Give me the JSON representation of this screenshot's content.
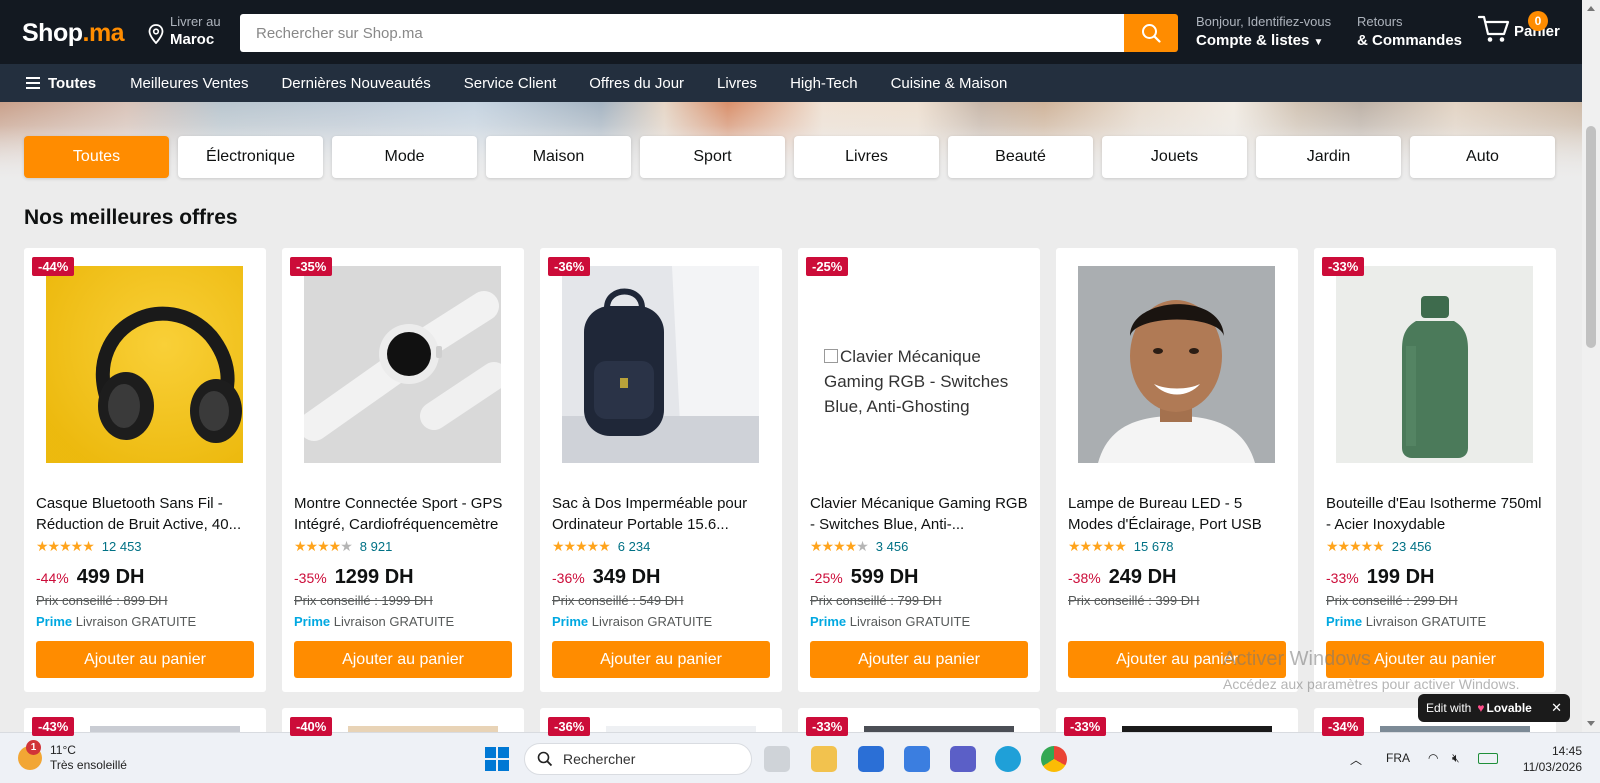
{
  "header": {
    "logo_main": "Shop",
    "logo_tld": ".ma",
    "deliver_small": "Livrer au",
    "deliver_big": "Maroc",
    "search_placeholder": "Rechercher sur Shop.ma",
    "account_small": "Bonjour, Identifiez-vous",
    "account_big": "Compte & listes",
    "returns_small": "Retours",
    "returns_big": "& Commandes",
    "cart_count": "0",
    "cart_label": "Panier"
  },
  "nav": {
    "all_label": "Toutes",
    "items": [
      "Meilleures Ventes",
      "Dernières Nouveautés",
      "Service Client",
      "Offres du Jour",
      "Livres",
      "High-Tech",
      "Cuisine & Maison"
    ]
  },
  "categories": [
    "Toutes",
    "Électronique",
    "Mode",
    "Maison",
    "Sport",
    "Livres",
    "Beauté",
    "Jouets",
    "Jardin",
    "Auto"
  ],
  "section_title": "Nos meilleures offres",
  "products": [
    {
      "badge": "-44%",
      "title": "Casque Bluetooth Sans Fil - Réduction de Bruit Active, 40...",
      "rating": 4.5,
      "reviews": "12 453",
      "discount": "-44%",
      "price": "499 DH",
      "was": "Prix conseillé : 899 DH",
      "prime": "Prime",
      "shipping": "Livraison GRATUITE",
      "button": "Ajouter au panier"
    },
    {
      "badge": "-35%",
      "title": "Montre Connectée Sport - GPS Intégré, Cardiofréquencemètre",
      "rating": 4,
      "reviews": "8 921",
      "discount": "-35%",
      "price": "1299 DH",
      "was": "Prix conseillé : 1999 DH",
      "prime": "Prime",
      "shipping": "Livraison GRATUITE",
      "button": "Ajouter au panier"
    },
    {
      "badge": "-36%",
      "title": "Sac à Dos Imperméable pour Ordinateur Portable 15.6...",
      "rating": 4.5,
      "reviews": "6 234",
      "discount": "-36%",
      "price": "349 DH",
      "was": "Prix conseillé : 549 DH",
      "prime": "Prime",
      "shipping": "Livraison GRATUITE",
      "button": "Ajouter au panier"
    },
    {
      "badge": "-25%",
      "alt": "Clavier Mécanique Gaming RGB - Switches Blue, Anti-Ghosting",
      "title": "Clavier Mécanique Gaming RGB - Switches Blue, Anti-...",
      "rating": 4,
      "reviews": "3 456",
      "discount": "-25%",
      "price": "599 DH",
      "was": "Prix conseillé : 799 DH",
      "prime": "Prime",
      "shipping": "Livraison GRATUITE",
      "button": "Ajouter au panier"
    },
    {
      "badge": "",
      "title": "Lampe de Bureau LED - 5 Modes d'Éclairage, Port USB",
      "rating": 4.5,
      "reviews": "15 678",
      "discount": "-38%",
      "price": "249 DH",
      "was": "Prix conseillé : 399 DH",
      "prime": "",
      "shipping": "",
      "button": "Ajouter au panier"
    },
    {
      "badge": "-33%",
      "title": "Bouteille d'Eau Isotherme 750ml - Acier Inoxydable",
      "rating": 4.5,
      "reviews": "23 456",
      "discount": "-33%",
      "price": "199 DH",
      "was": "Prix conseillé : 299 DH",
      "prime": "Prime",
      "shipping": "Livraison GRATUITE",
      "button": "Ajouter au panier"
    }
  ],
  "row2_badges": [
    "-43%",
    "-40%",
    "-36%",
    "-33%",
    "-33%",
    "-34%"
  ],
  "watermark": {
    "line1": "Activer Windows",
    "line2": "Accédez aux paramètres pour activer Windows."
  },
  "lovable": {
    "prefix": "Edit with",
    "brand": "Lovable",
    "close": "✕"
  },
  "taskbar": {
    "temp": "11°C",
    "weather": "Très ensoleillé",
    "notif_count": "1",
    "search_label": "Rechercher",
    "lang": "FRA",
    "time": "14:45",
    "date": "11/03/2026"
  },
  "colors": {
    "accent": "#ff8c00",
    "header_bg": "#131921",
    "nav_bg": "#232f3e",
    "deal_red": "#cc0c39",
    "prime_blue": "#00a8e1",
    "link_teal": "#007185"
  }
}
